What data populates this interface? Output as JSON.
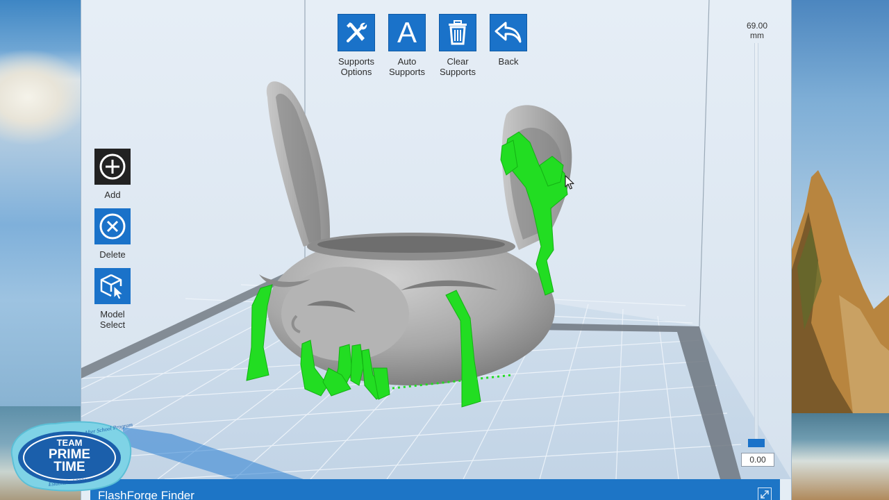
{
  "toolbar": {
    "supports_options": "Supports\nOptions",
    "auto_supports": "Auto\nSupports",
    "auto_supports_glyph": "A",
    "clear_supports": "Clear\nSupports",
    "back": "Back"
  },
  "left_tools": {
    "add": "Add",
    "delete": "Delete",
    "model_select": "Model\nSelect"
  },
  "height_slider": {
    "max_value": "69.00",
    "unit": "mm",
    "current_value": "0.00",
    "level": 0
  },
  "finder": {
    "title": "FlashForge Finder"
  },
  "watermark": {
    "top_text": "After School Program",
    "line1": "TEAM",
    "line2": "PRIME",
    "line3": "TIME",
    "bottom_text": "Established 2001"
  },
  "colors": {
    "accent": "#1a72c9",
    "support_green": "#22dd22",
    "model_gray": "#9a9a9a"
  },
  "icons": {
    "supports_options": "tools-icon",
    "auto_supports": "letter-a-icon",
    "clear_supports": "trash-icon",
    "back": "back-arrow-icon",
    "add": "plus-circle-icon",
    "delete": "x-circle-icon",
    "model_select": "cube-cursor-icon"
  }
}
